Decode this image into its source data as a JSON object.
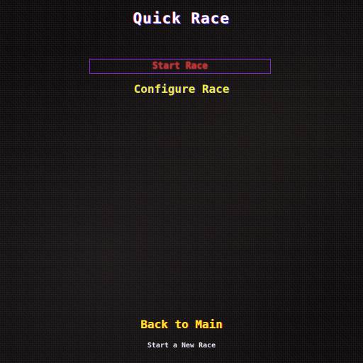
{
  "screen": {
    "title": "Quick Race",
    "start_button_label": "Start Race",
    "section_heading": "Configure Race",
    "back_label": "Back to Main",
    "hint_text": "Start a New Race"
  },
  "colors": {
    "title": "#ffffff",
    "button_border": "#8a2bd6",
    "button_text": "#e23a3a",
    "heading": "#f6ee2a",
    "background": "#0c0a0a"
  }
}
